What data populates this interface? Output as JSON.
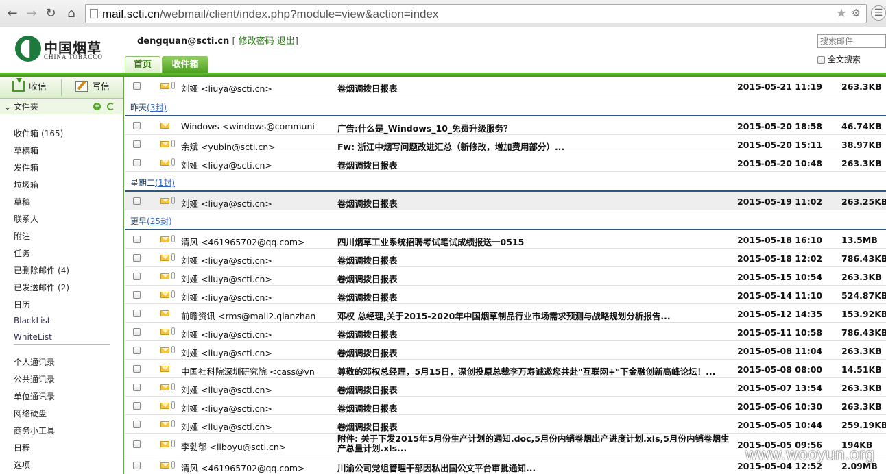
{
  "browser": {
    "url_host": "mail.scti.cn",
    "url_path": "/webmail/client/index.php?module=view&action=index"
  },
  "header": {
    "logo_cn": "中国烟草",
    "logo_en": "CHINA TOBACCO",
    "user_email": "dengquan@scti.cn",
    "bracket_open": "[",
    "change_password": "修改密码",
    "logout": "退出",
    "bracket_close": "]",
    "tab_home": "首页",
    "tab_inbox": "收件箱",
    "search_placeholder": "搜索邮件",
    "fulltext_label": "全文搜索"
  },
  "sidebar": {
    "receive": "收信",
    "write": "写信",
    "folder_header": "文件夹",
    "folders": [
      {
        "label": "收件箱",
        "count": "(165)"
      },
      {
        "label": "草稿箱",
        "count": ""
      },
      {
        "label": "发件箱",
        "count": ""
      },
      {
        "label": "垃圾箱",
        "count": ""
      },
      {
        "label": "草稿",
        "count": ""
      },
      {
        "label": "联系人",
        "count": ""
      },
      {
        "label": "附注",
        "count": ""
      },
      {
        "label": "任务",
        "count": ""
      },
      {
        "label": "已删除邮件",
        "count": "(4)"
      },
      {
        "label": "已发送邮件",
        "count": "(2)"
      },
      {
        "label": "日历",
        "count": ""
      },
      {
        "label": "BlackList",
        "count": ""
      },
      {
        "label": "WhiteList",
        "count": ""
      }
    ],
    "tools": [
      "个人通讯录",
      "公共通讯录",
      "单位通讯录",
      "网络硬盘",
      "商务小工具",
      "日程",
      "选项"
    ]
  },
  "mail_list": {
    "groups": [
      {
        "label": "昨天",
        "count": "(3封)"
      },
      {
        "label": "星期二",
        "count": "(1封)"
      },
      {
        "label": "更早",
        "count": "(25封)"
      }
    ],
    "rows": [
      {
        "from": "刘娅 <liuya@scti.cn>",
        "subject": "卷烟调拨日报表",
        "date": "2015-05-21 11:19",
        "size": "263.3KB",
        "attach": true
      },
      {
        "from": "Windows <windows@communic",
        "subject": "广告:什么是_Windows_10_免费升级服务？",
        "date": "2015-05-20 18:58",
        "size": "46.74KB",
        "attach": false
      },
      {
        "from": "余斌 <yubin@scti.cn>",
        "subject": "Fw: 浙江中烟写问题改进汇总（新修改，增加费用部分）...",
        "date": "2015-05-20 15:11",
        "size": "38.97KB",
        "attach": true
      },
      {
        "from": "刘娅 <liuya@scti.cn>",
        "subject": "卷烟调拨日报表",
        "date": "2015-05-20 10:48",
        "size": "263.3KB",
        "attach": true
      },
      {
        "from": "刘娅 <liuya@scti.cn>",
        "subject": "卷烟调拨日报表",
        "date": "2015-05-19 11:02",
        "size": "263.25KB",
        "attach": true
      },
      {
        "from": "清风 <461965702@qq.com>",
        "subject": "四川烟草工业系统招聘考试笔试成绩报送一0515",
        "date": "2015-05-18 16:10",
        "size": "13.5MB",
        "attach": true
      },
      {
        "from": "刘娅 <liuya@scti.cn>",
        "subject": "卷烟调拨日报表",
        "date": "2015-05-18 12:02",
        "size": "786.43KB",
        "attach": true
      },
      {
        "from": "刘娅 <liuya@scti.cn>",
        "subject": "卷烟调拨日报表",
        "date": "2015-05-15 10:54",
        "size": "263.3KB",
        "attach": true
      },
      {
        "from": "刘娅 <liuya@scti.cn>",
        "subject": "卷烟调拨日报表",
        "date": "2015-05-14 11:10",
        "size": "524.87KB",
        "attach": true
      },
      {
        "from": "前瞻资讯 <rms@mail2.qianzhan.",
        "subject": "邓权 总经理,关于2015-2020年中国烟草制品行业市场需求预测与战略规划分析报告...",
        "date": "2015-05-12 14:35",
        "size": "153.92KB",
        "attach": false
      },
      {
        "from": "刘娅 <liuya@scti.cn>",
        "subject": "卷烟调拨日报表",
        "date": "2015-05-11 10:58",
        "size": "786.43KB",
        "attach": true
      },
      {
        "from": "刘娅 <liuya@scti.cn>",
        "subject": "卷烟调拨日报表",
        "date": "2015-05-08 11:04",
        "size": "263.3KB",
        "attach": true
      },
      {
        "from": "中国社科院深圳研究院 <cass@vn",
        "subject": "尊敬的邓权总经理，5月15日，深创投原总裁李万寿诚邀您共赴\"互联网+\"下金融创新高峰论坛！...",
        "date": "2015-05-08 08:00",
        "size": "14.51KB",
        "attach": false
      },
      {
        "from": "刘娅 <liuya@scti.cn>",
        "subject": "卷烟调拨日报表",
        "date": "2015-05-07 13:54",
        "size": "263.3KB",
        "attach": true
      },
      {
        "from": "刘娅 <liuya@scti.cn>",
        "subject": "卷烟调拨日报表",
        "date": "2015-05-06 10:30",
        "size": "263.3KB",
        "attach": true
      },
      {
        "from": "刘娅 <liuya@scti.cn>",
        "subject": "卷烟调拨日报表",
        "date": "2015-05-05 10:44",
        "size": "259.19KB",
        "attach": true
      },
      {
        "from": "李勃郁 <liboyu@scti.cn>",
        "subject": "附件: 关于下发2015年5月份生产计划的通知.doc,5月份内销卷烟出产进度计划.xls,5月份内销卷烟生产总量计划.xls...",
        "date": "2015-05-05 09:56",
        "size": "194KB",
        "attach": true
      },
      {
        "from": "清风 <461965702@qq.com>",
        "subject": "川渝公司党组管理干部因私出国公文平台审批通知...",
        "date": "2015-05-04 12:52",
        "size": "2.09MB",
        "attach": true
      }
    ]
  },
  "watermark": "www.wooyun.org"
}
